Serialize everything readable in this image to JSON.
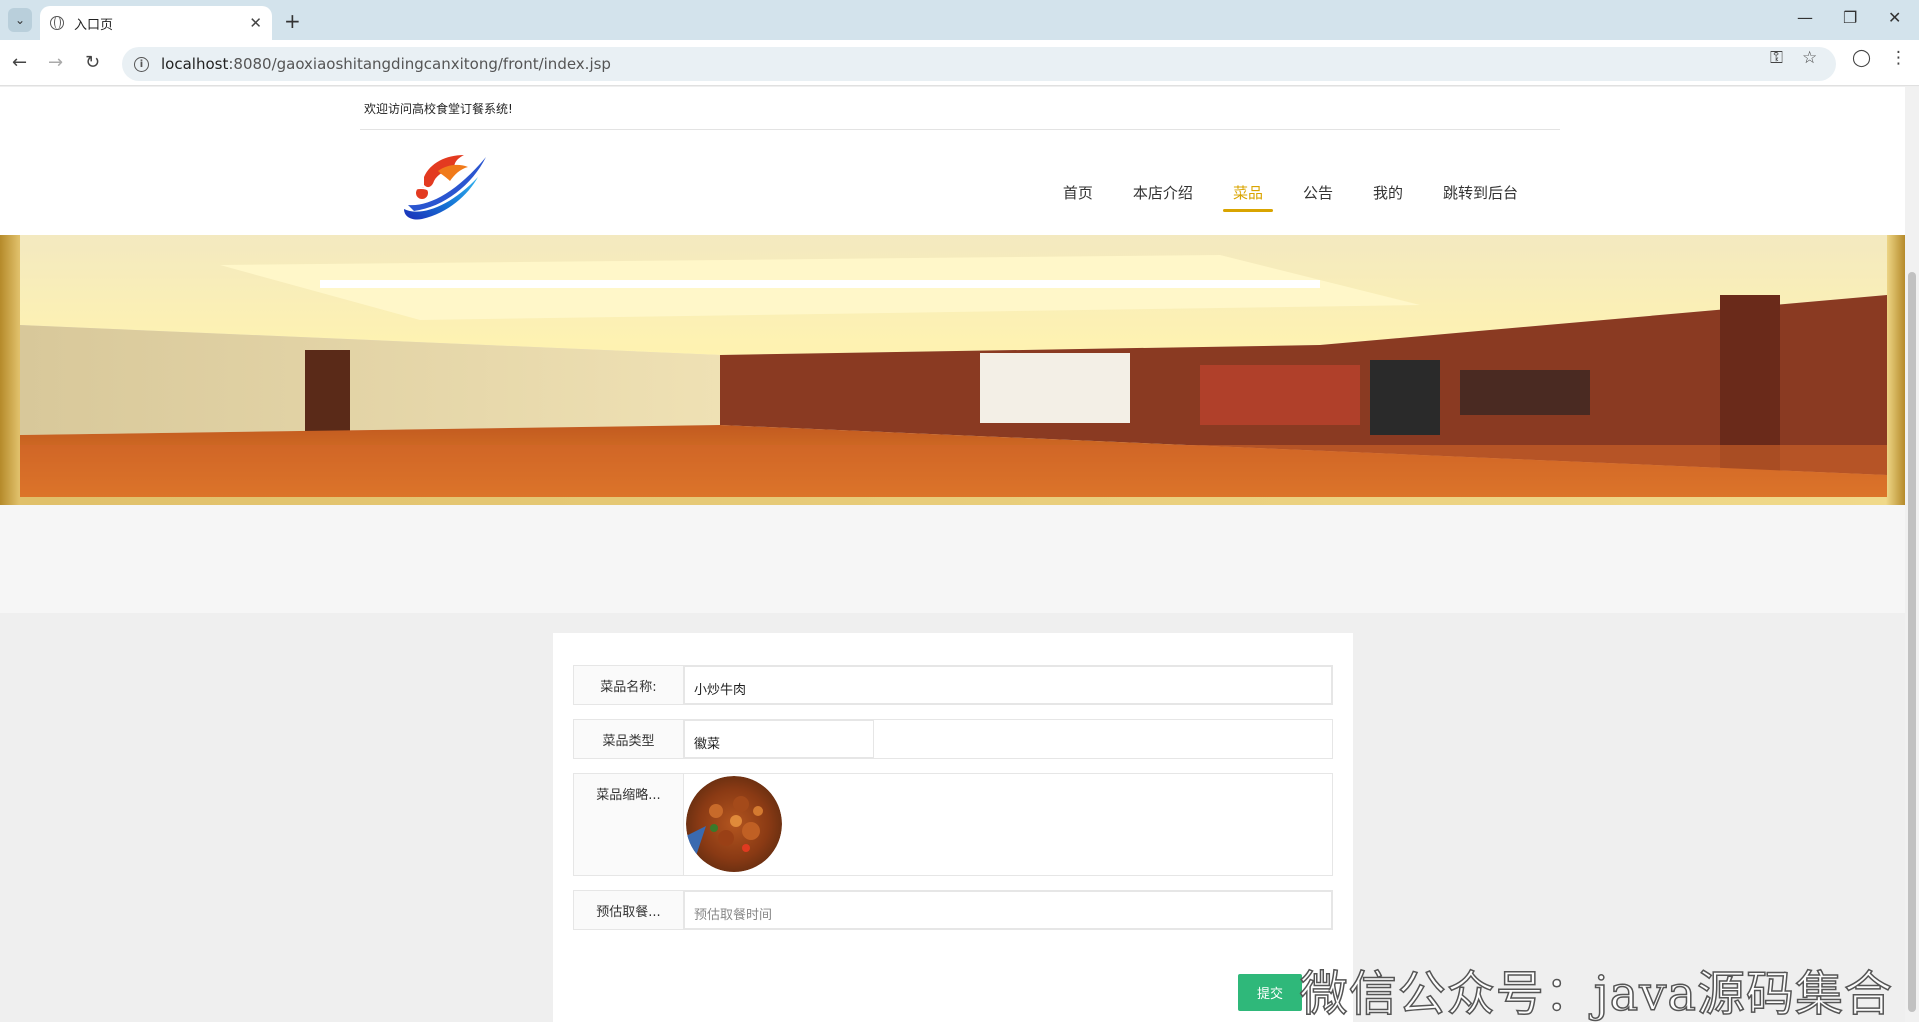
{
  "browser": {
    "tab_title": "入口页",
    "url_host": "localhost",
    "url_path": ":8080/gaoxiaoshitangdingcanxitong/front/index.jsp"
  },
  "header": {
    "welcome": "欢迎访问高校食堂订餐系统!",
    "nav": [
      {
        "label": "首页"
      },
      {
        "label": "本店介绍"
      },
      {
        "label": "菜品",
        "active": true
      },
      {
        "label": "公告"
      },
      {
        "label": "我的"
      },
      {
        "label": "跳转到后台"
      }
    ]
  },
  "form": {
    "name_label": "菜品名称:",
    "name_value": "小炒牛肉",
    "type_label": "菜品类型",
    "type_value": "徽菜",
    "thumb_label": "菜品缩略...",
    "time_label": "预估取餐...",
    "time_placeholder": "预估取餐时间",
    "submit_label": "提交"
  },
  "watermark": "微信公众号：java源码集合",
  "colors": {
    "accent": "#d9a400",
    "submit": "#2fb87a"
  }
}
